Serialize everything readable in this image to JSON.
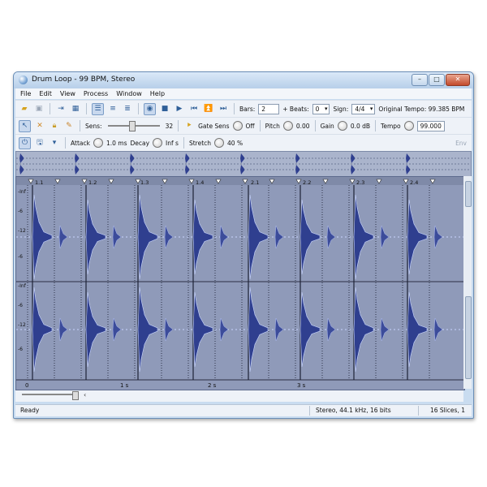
{
  "window": {
    "title": "Drum Loop - 99 BPM, Stereo"
  },
  "menu": [
    "File",
    "Edit",
    "View",
    "Process",
    "Window",
    "Help"
  ],
  "toolbar1": {
    "bars_label": "Bars:",
    "bars_value": "2",
    "beats_label": "+ Beats:",
    "beats_value": "0",
    "sign_label": "Sign:",
    "sign_value": "4/4",
    "tempo_text": "Original Tempo: 99.385 BPM"
  },
  "toolbar2": {
    "sens_label": "Sens:",
    "sens_value": "32",
    "sens_level": 0.45,
    "gate_label": "Gate Sens",
    "gate_value": "Off",
    "pitch_label": "Pitch",
    "pitch_value": "0.00",
    "gain_label": "Gain",
    "gain_value": "0.0 dB",
    "tempo_label": "Tempo",
    "tempo_value": "99.000"
  },
  "toolbar3": {
    "attack_label": "Attack",
    "attack_value": "1.0 ms",
    "decay_label": "Decay",
    "decay_value": "Inf s",
    "stretch_label": "Stretch",
    "stretch_value": "40 %",
    "env_label": "Env"
  },
  "slices": {
    "labels": [
      "1.1",
      "1.2",
      "1.3",
      "1.4",
      "2.1",
      "2.2",
      "2.3",
      "2.4"
    ],
    "db_labels": [
      "-Inf",
      "-6",
      "-12",
      "-6",
      "-Inf",
      "-6",
      "-12",
      "-6"
    ],
    "time_labels": [
      "1 s",
      "2 s",
      "3 s"
    ],
    "zero_label": "0"
  },
  "status": {
    "ready": "Ready",
    "format": "Stereo, 44.1 kHz, 16 bits",
    "slices": "16 Slices, 1"
  },
  "colors": {
    "wave_bg": "#8f9ab9",
    "wave_fill": "#2f3f8f",
    "wave_edge": "#c9d6ff"
  }
}
